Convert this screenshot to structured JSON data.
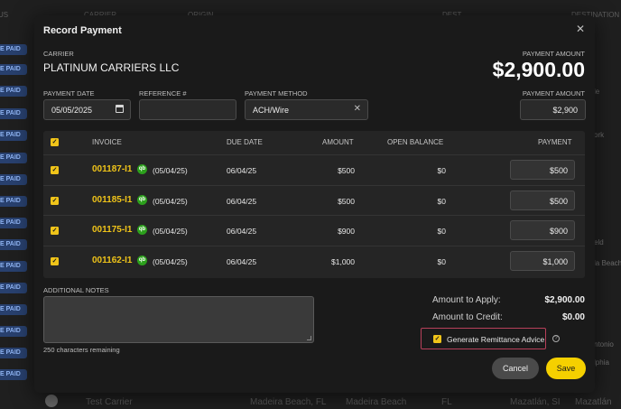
{
  "background": {
    "headers": [
      "US",
      "CARRIER",
      "ORIGIN",
      "DEST.",
      "DESTINATION CITY"
    ],
    "badge_label": "E PAID",
    "right_texts": [
      "le",
      "ork",
      "eld",
      "la Beach",
      "ntonio",
      "lphia"
    ],
    "bottom_row": {
      "carrier": "Test Carrier",
      "origin": "Madeira Beach, FL",
      "origin_city": "Madeira Beach",
      "state": "FL",
      "dest": "Mazatlán, SI",
      "dest_city": "Mazatlán"
    }
  },
  "modal": {
    "title": "Record Payment",
    "close_icon": "close-icon",
    "carrier_label": "CARRIER",
    "carrier_name": "PLATINUM CARRIERS LLC",
    "payment_amount_label": "PAYMENT AMOUNT",
    "payment_amount_value": "$2,900.00",
    "fields": {
      "payment_date_label": "PAYMENT DATE",
      "payment_date_value": "05/05/2025",
      "reference_label": "REFERENCE #",
      "reference_value": "",
      "method_label": "PAYMENT METHOD",
      "method_value": "ACH/Wire",
      "amount_label": "PAYMENT AMOUNT",
      "amount_value": "$2,900"
    },
    "table": {
      "headers": {
        "invoice": "INVOICE",
        "due_date": "DUE DATE",
        "amount": "AMOUNT",
        "open_balance": "OPEN BALANCE",
        "payment": "PAYMENT"
      },
      "rows": [
        {
          "invoice": "001187-I1",
          "qb": "qb",
          "qb_date": "(05/04/25)",
          "due": "06/04/25",
          "amount": "$500",
          "open": "$0",
          "payment": "$500"
        },
        {
          "invoice": "001185-I1",
          "qb": "qb",
          "qb_date": "(05/04/25)",
          "due": "06/04/25",
          "amount": "$500",
          "open": "$0",
          "payment": "$500"
        },
        {
          "invoice": "001175-I1",
          "qb": "qb",
          "qb_date": "(05/04/25)",
          "due": "06/04/25",
          "amount": "$900",
          "open": "$0",
          "payment": "$900"
        },
        {
          "invoice": "001162-I1",
          "qb": "qb",
          "qb_date": "(05/04/25)",
          "due": "06/04/25",
          "amount": "$1,000",
          "open": "$0",
          "payment": "$1,000"
        }
      ]
    },
    "notes_label": "ADDITIONAL NOTES",
    "chars_remaining": "250 characters remaining",
    "summary": {
      "apply_label": "Amount to Apply:",
      "apply_value": "$2,900.00",
      "credit_label": "Amount to Credit:",
      "credit_value": "$0.00"
    },
    "remittance_label": "Generate Remittance Advice",
    "help_glyph": "?",
    "cancel_label": "Cancel",
    "save_label": "Save"
  },
  "colors": {
    "accent": "#f0c419",
    "save": "#f5d000",
    "quickbooks": "#2ca01c",
    "highlight_border": "#b8405a",
    "badge": "#28406e"
  }
}
